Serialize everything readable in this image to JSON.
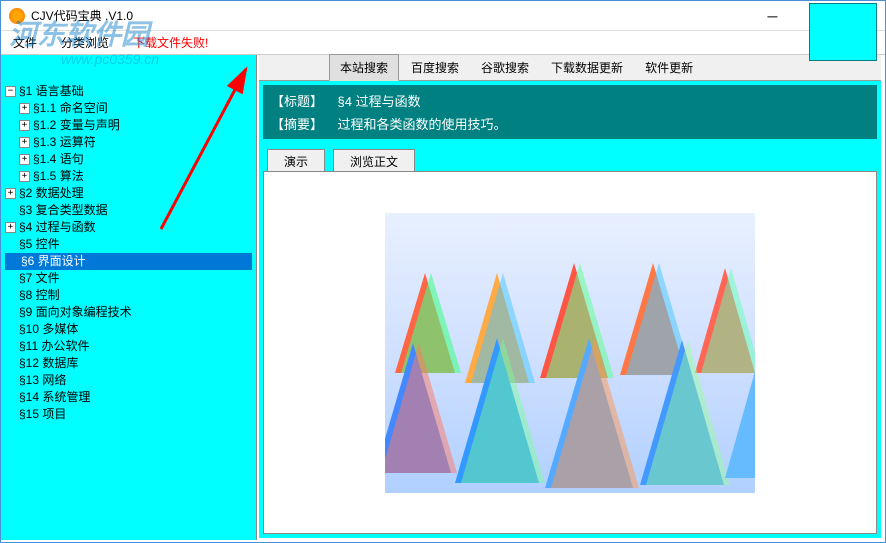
{
  "window": {
    "title": "CJV代码宝典 .V1.0"
  },
  "menu": {
    "file": "文件",
    "browse": "分类浏览",
    "error": "下载文件失败!"
  },
  "search_tabs": {
    "site": "本站搜索",
    "baidu": "百度搜索",
    "google": "谷歌搜索",
    "data_update": "下载数据更新",
    "soft_update": "软件更新"
  },
  "tree": {
    "s1": "§1  语言基础",
    "s1_1": "§1.1  命名空间",
    "s1_2": "§1.2  变量与声明",
    "s1_3": "§1.3  运算符",
    "s1_4": "§1.4  语句",
    "s1_5": "§1.5  算法",
    "s2": "§2  数据处理",
    "s3": "§3  复合类型数据",
    "s4": "§4  过程与函数",
    "s5": "§5  控件",
    "s6": "§6  界面设计",
    "s7": "§7  文件",
    "s8": "§8  控制",
    "s9": "§9  面向对象编程技术",
    "s10": "§10  多媒体",
    "s11": "§11  办公软件",
    "s12": "§12  数据库",
    "s13": "§13  网络",
    "s14": "§14  系统管理",
    "s15": "§15  项目"
  },
  "info": {
    "title_label": "【标题】",
    "title_value": "§4  过程与函数",
    "summary_label": "【摘要】",
    "summary_value": "过程和各类函数的使用技巧。"
  },
  "actions": {
    "demo": "演示",
    "view": "浏览正文"
  },
  "watermark": {
    "main": "河东软件园",
    "sub": "www.pc0359.cn"
  }
}
